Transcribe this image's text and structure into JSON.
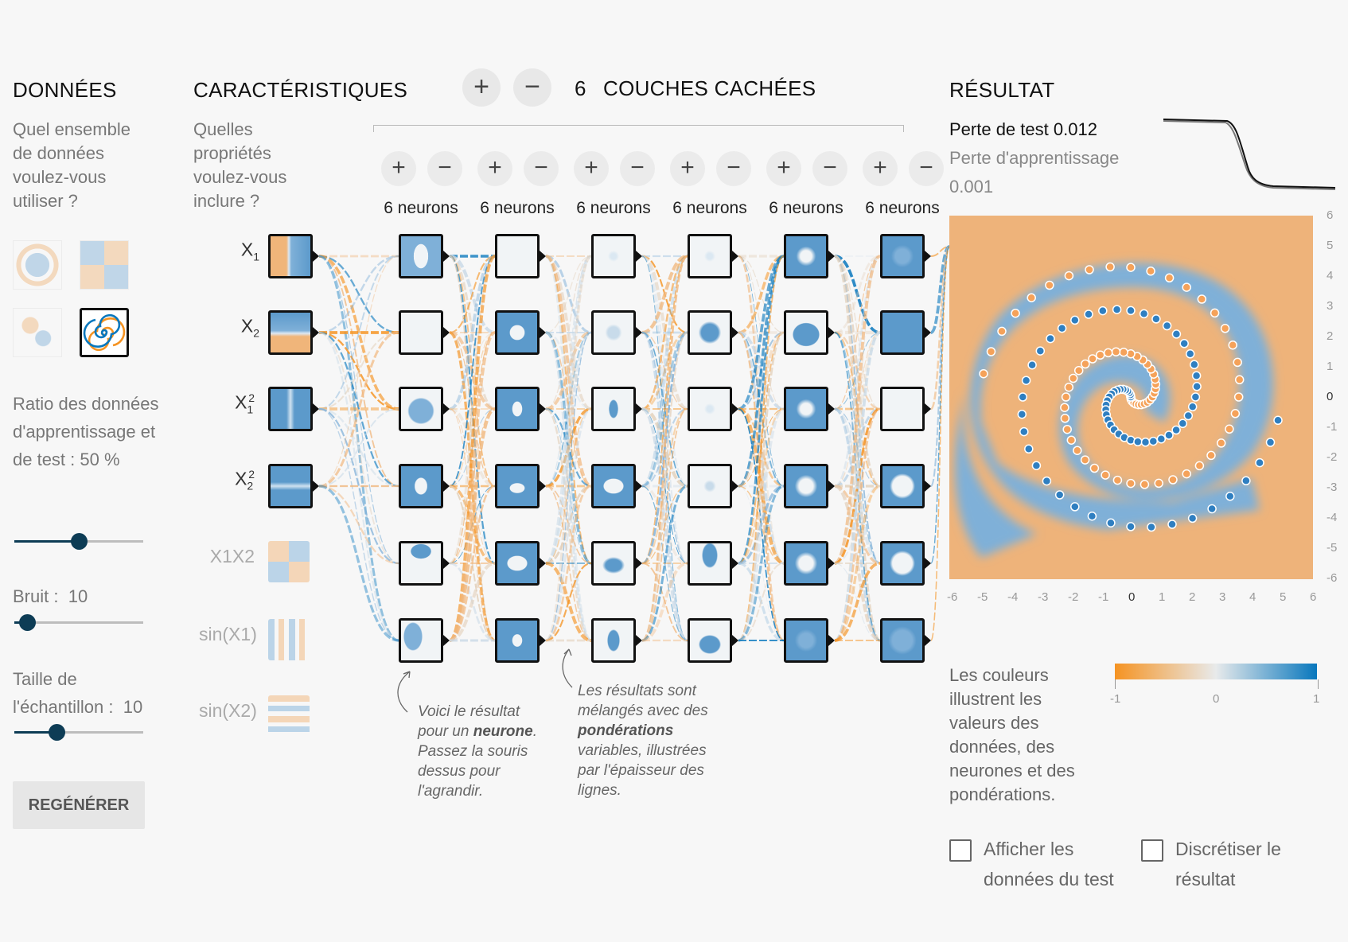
{
  "data_section": {
    "title": "DONNÉES",
    "question": "Quel ensemble de données voulez-vous utiliser ?",
    "datasets": [
      "circle-dataset",
      "xor-dataset",
      "gaussian-dataset",
      "spiral-dataset"
    ],
    "selected_dataset": "spiral-dataset",
    "ratio_label": "Ratio des données d'apprentissage et de test :",
    "ratio_value": "50 %",
    "ratio_fraction": 0.5,
    "noise_label": "Bruit :",
    "noise_value": "10",
    "noise_fraction": 0.1,
    "batch_label": "Taille de l'échantillon :",
    "batch_value": "10",
    "batch_fraction": 0.33,
    "regenerate": "REGÉNÉRER"
  },
  "features_section": {
    "title": "CARACTÉRISTIQUES",
    "question": "Quelles propriétés voulez-vous inclure ?",
    "features": [
      {
        "id": "x1",
        "base": "X",
        "sub": "1",
        "sup": "",
        "active": true
      },
      {
        "id": "x2",
        "base": "X",
        "sub": "2",
        "sup": "",
        "active": true
      },
      {
        "id": "x1sq",
        "base": "X",
        "sub": "1",
        "sup": "2",
        "active": true
      },
      {
        "id": "x2sq",
        "base": "X",
        "sub": "2",
        "sup": "2",
        "active": true
      },
      {
        "id": "x1x2",
        "base": "X1X2",
        "sub": "",
        "sup": "",
        "active": false
      },
      {
        "id": "sinx1",
        "base": "sin(X1)",
        "sub": "",
        "sup": "",
        "active": false
      },
      {
        "id": "sinx2",
        "base": "sin(X2)",
        "sub": "",
        "sup": "",
        "active": false
      }
    ]
  },
  "layers_section": {
    "add": "+",
    "remove": "−",
    "count": "6",
    "title": "COUCHES CACHÉES",
    "layers": [
      {
        "neurons_label": "6 neurons"
      },
      {
        "neurons_label": "6 neurons"
      },
      {
        "neurons_label": "6 neurons"
      },
      {
        "neurons_label": "6 neurons"
      },
      {
        "neurons_label": "6 neurons"
      },
      {
        "neurons_label": "6 neurons"
      }
    ],
    "note1_a": "Voici le résultat pour un ",
    "note1_b": "neurone",
    "note1_c": ". Passez la souris dessus pour l'agrandir.",
    "note2_a": "Les résultats sont mélangés avec des ",
    "note2_b": "pondérations",
    "note2_c": " variables, illustrées par l'épaisseur des lignes."
  },
  "output_section": {
    "title": "RÉSULTAT",
    "test_loss_label": "Perte de test",
    "test_loss_value": "0.012",
    "train_loss_label": "Perte d'apprentissage",
    "train_loss_value": "0.001",
    "x_ticks": [
      "-6",
      "-5",
      "-4",
      "-3",
      "-2",
      "-1",
      "0",
      "1",
      "2",
      "3",
      "4",
      "5",
      "6"
    ],
    "y_ticks": [
      "6",
      "5",
      "4",
      "3",
      "2",
      "1",
      "0",
      "-1",
      "-2",
      "-3",
      "-4",
      "-5",
      "-6"
    ],
    "legend_text": "Les couleurs illustrent les valeurs des données, des neurones et des pondérations.",
    "legend_ticks": [
      "-1",
      "0",
      "1"
    ],
    "show_test_label": "Afficher les données du test",
    "discretize_label": "Discrétiser le résultat"
  },
  "colors": {
    "orange": "#f59322",
    "blue": "#0877bd",
    "light_orange": "#f0b57a",
    "light_blue": "#7fb0d8",
    "dark": "#0d3c55"
  }
}
